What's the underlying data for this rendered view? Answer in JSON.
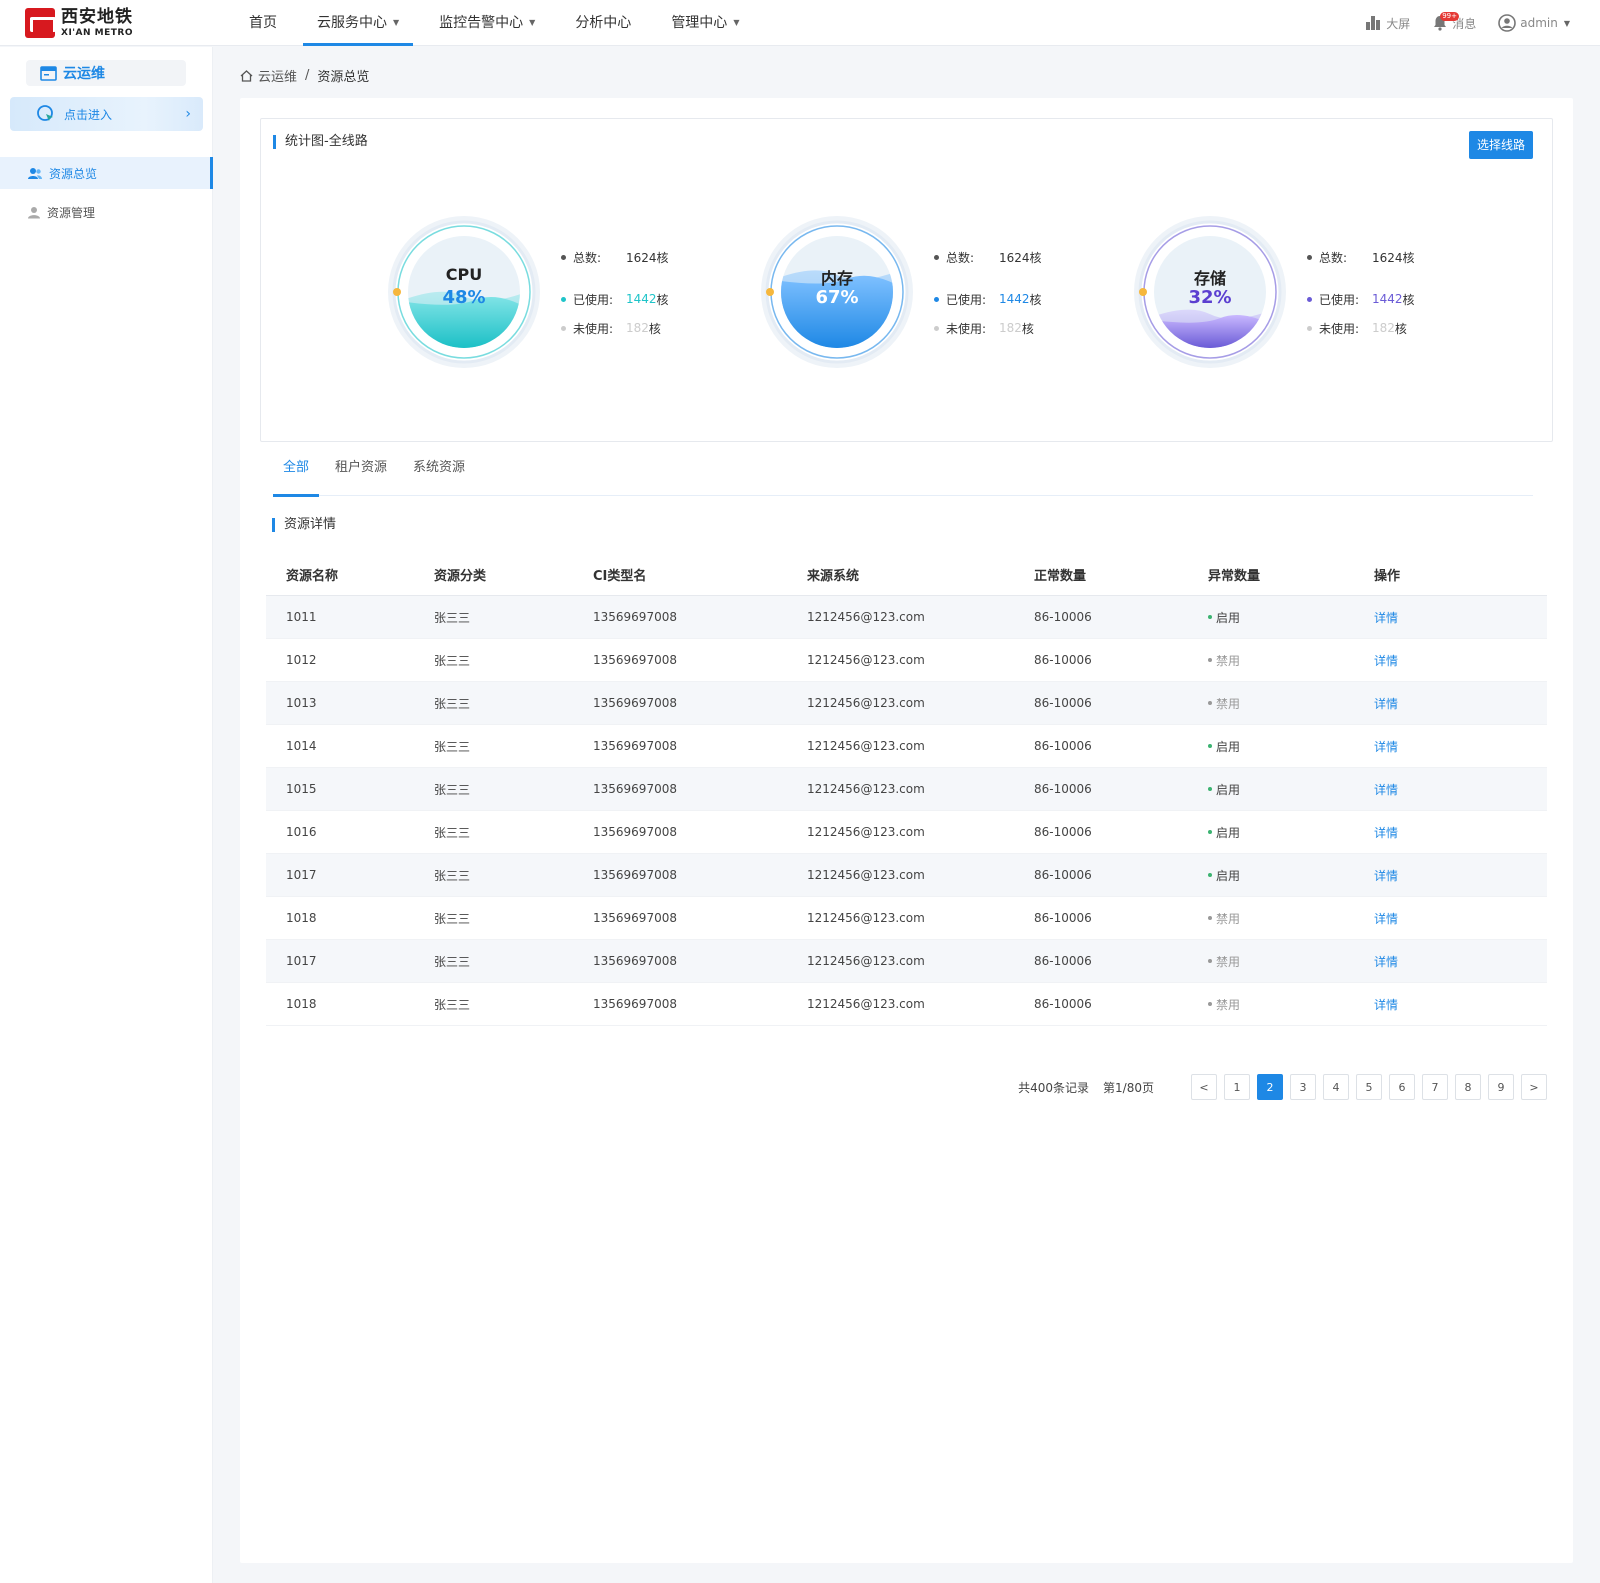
{
  "header": {
    "logo_cn": "西安地铁",
    "logo_en": "XI'AN METRO",
    "nav": [
      {
        "label": "首页"
      },
      {
        "label": "云服务中心"
      },
      {
        "label": "监控告警中心"
      },
      {
        "label": "分析中心"
      },
      {
        "label": "管理中心"
      }
    ],
    "screen_label": "大屏",
    "message_label": "消息",
    "message_badge": "99+",
    "user_label": "admin"
  },
  "sidebar": {
    "title": "云运维",
    "enter_label": "点击进入",
    "items": [
      {
        "label": "资源总览"
      },
      {
        "label": "资源管理"
      }
    ]
  },
  "breadcrumb": {
    "root": "云运维",
    "separator": "/",
    "current": "资源总览"
  },
  "stats": {
    "title": "统计图-全线路",
    "select_button": "选择线路",
    "total_label": "总数:",
    "used_label": "已使用:",
    "unused_label": "未使用:",
    "gauges": [
      {
        "name": "CPU",
        "percent": 48,
        "percent_text": "48%",
        "total": "1624核",
        "used": "1442",
        "unused": "182",
        "unit": "核",
        "color": "#1fc4c9"
      },
      {
        "name": "内存",
        "percent": 67,
        "percent_text": "67%",
        "total": "1624核",
        "used": "1442",
        "unused": "182",
        "unit": "核",
        "color": "#1e88e5"
      },
      {
        "name": "存储",
        "percent": 32,
        "percent_text": "32%",
        "total": "1624核",
        "used": "1442",
        "unused": "182",
        "unit": "核",
        "color": "#6a5bd6"
      }
    ]
  },
  "tabs": [
    {
      "label": "全部"
    },
    {
      "label": "租户资源"
    },
    {
      "label": "系统资源"
    }
  ],
  "table": {
    "title": "资源详情",
    "columns": [
      "资源名称",
      "资源分类",
      "CI类型名",
      "来源系统",
      "正常数量",
      "异常数量",
      "操作"
    ],
    "rows": [
      {
        "name": "1011",
        "category": "张三三",
        "ci": "13569697008",
        "source": "1212456@123.com",
        "normal": "86-10006",
        "status": "启用",
        "action": "详情"
      },
      {
        "name": "1012",
        "category": "张三三",
        "ci": "13569697008",
        "source": "1212456@123.com",
        "normal": "86-10006",
        "status": "禁用",
        "action": "详情"
      },
      {
        "name": "1013",
        "category": "张三三",
        "ci": "13569697008",
        "source": "1212456@123.com",
        "normal": "86-10006",
        "status": "禁用",
        "action": "详情"
      },
      {
        "name": "1014",
        "category": "张三三",
        "ci": "13569697008",
        "source": "1212456@123.com",
        "normal": "86-10006",
        "status": "启用",
        "action": "详情"
      },
      {
        "name": "1015",
        "category": "张三三",
        "ci": "13569697008",
        "source": "1212456@123.com",
        "normal": "86-10006",
        "status": "启用",
        "action": "详情"
      },
      {
        "name": "1016",
        "category": "张三三",
        "ci": "13569697008",
        "source": "1212456@123.com",
        "normal": "86-10006",
        "status": "启用",
        "action": "详情"
      },
      {
        "name": "1017",
        "category": "张三三",
        "ci": "13569697008",
        "source": "1212456@123.com",
        "normal": "86-10006",
        "status": "启用",
        "action": "详情"
      },
      {
        "name": "1018",
        "category": "张三三",
        "ci": "13569697008",
        "source": "1212456@123.com",
        "normal": "86-10006",
        "status": "禁用",
        "action": "详情"
      },
      {
        "name": "1017",
        "category": "张三三",
        "ci": "13569697008",
        "source": "1212456@123.com",
        "normal": "86-10006",
        "status": "禁用",
        "action": "详情"
      },
      {
        "name": "1018",
        "category": "张三三",
        "ci": "13569697008",
        "source": "1212456@123.com",
        "normal": "86-10006",
        "status": "禁用",
        "action": "详情"
      }
    ]
  },
  "pagination": {
    "total_text": "共400条记录",
    "page_text": "第1/80页",
    "pages": [
      "1",
      "2",
      "3",
      "4",
      "5",
      "6",
      "7",
      "8",
      "9"
    ],
    "current": "2",
    "prev": "<",
    "next": ">"
  }
}
